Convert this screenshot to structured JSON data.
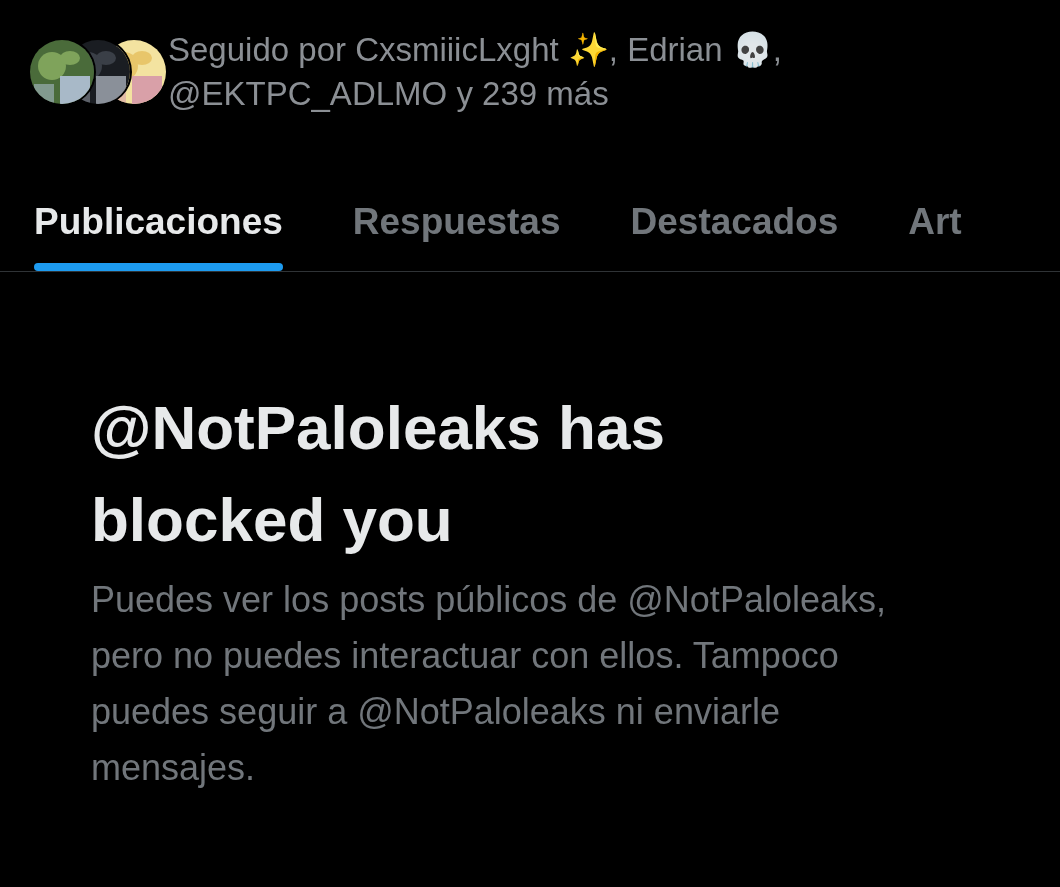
{
  "followed_by": {
    "text": "Seguido por CxsmiiicLxght ✨, Edrian 💀, @EKTPC_ADLMO y 239 más"
  },
  "tabs": [
    {
      "label": "Publicaciones",
      "selected": true
    },
    {
      "label": "Respuestas",
      "selected": false
    },
    {
      "label": "Destacados",
      "selected": false
    },
    {
      "label": "Art",
      "selected": false
    }
  ],
  "blocked": {
    "title": "@NotPaloleaks has blocked you",
    "message": "Puedes ver los posts públicos de @NotPaloleaks, pero no puedes interactuar con ellos. Tampoco puedes seguir a @NotPaloleaks ni enviarle mensajes."
  }
}
